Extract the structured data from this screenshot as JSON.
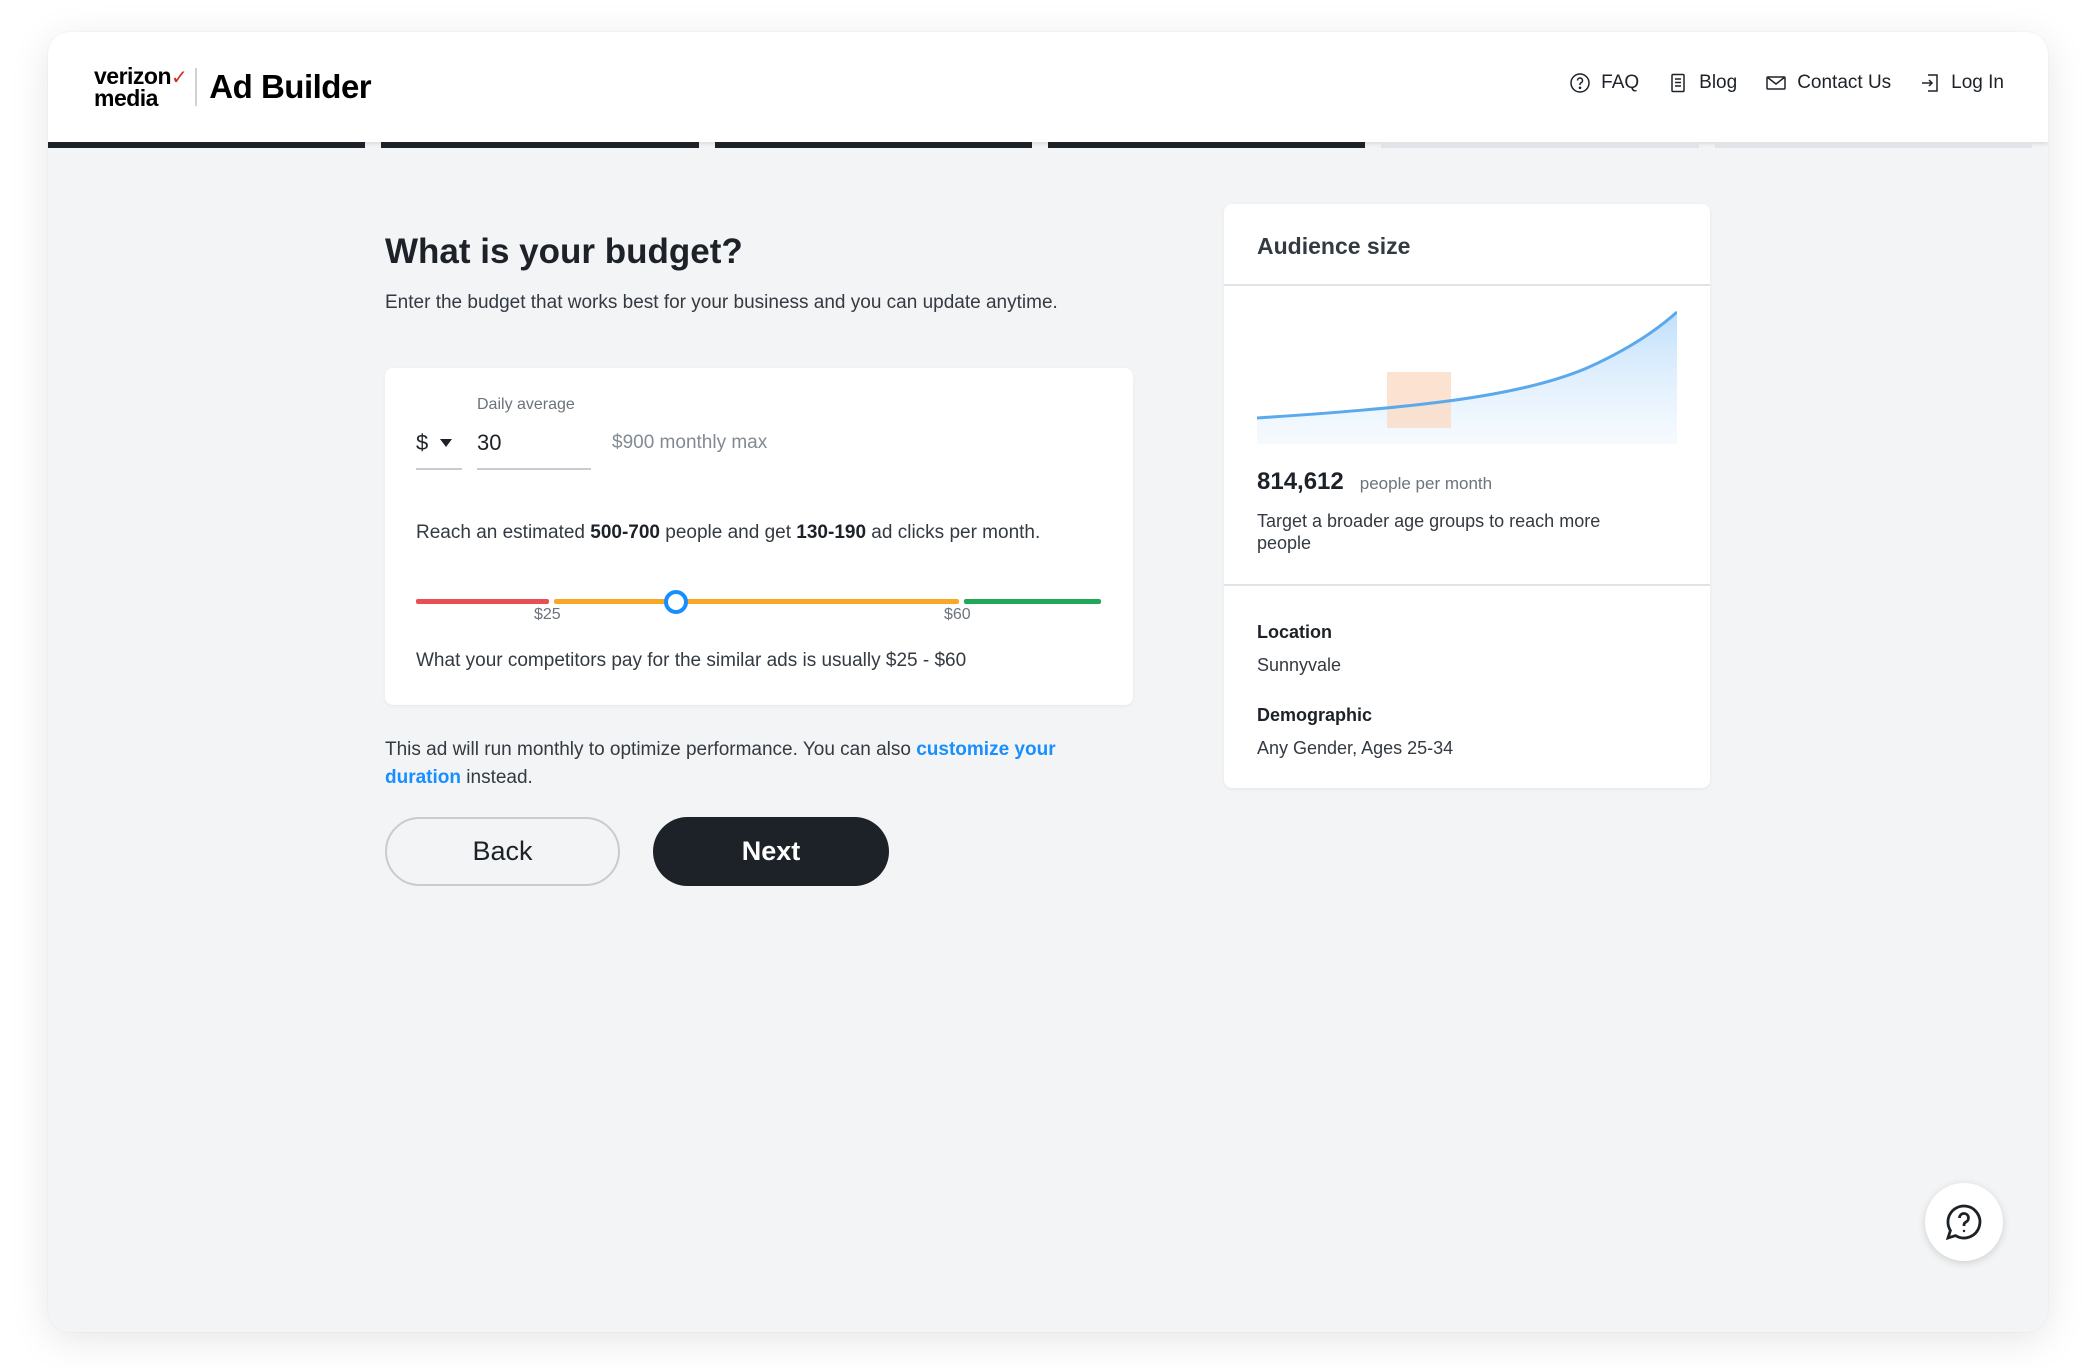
{
  "header": {
    "brand_line1": "verizon",
    "brand_check": "✓",
    "brand_line2": "media",
    "app_title": "Ad Builder",
    "nav": [
      {
        "label": "FAQ",
        "icon": "question-circle-icon"
      },
      {
        "label": "Blog",
        "icon": "document-icon"
      },
      {
        "label": "Contact Us",
        "icon": "envelope-icon"
      },
      {
        "label": "Log In",
        "icon": "login-icon"
      }
    ]
  },
  "progress": {
    "total_steps": 6,
    "completed_steps": 4,
    "done_color": "#1d2228",
    "todo_color": "#e0e4e9"
  },
  "main": {
    "title": "What is your budget?",
    "subtitle": "Enter the budget that works best for your business and you can update anytime."
  },
  "budget": {
    "currency": "$",
    "label": "Daily average",
    "value": "30",
    "monthly_max": "$900 monthly max",
    "reach_pre": "Reach an estimated ",
    "reach_people": "500-700",
    "reach_mid": " people and get ",
    "reach_clicks": "130-190",
    "reach_post": " ad clicks per month.",
    "tick_low": "$25",
    "tick_high": "$60",
    "competitors": "What your competitors pay for the similar ads is usually $25 - $60",
    "colors": {
      "low": "#eb4e52",
      "mid": "#f9a825",
      "high": "#1ea858",
      "thumb": "#188fff"
    }
  },
  "duration": {
    "pre": "This ad will run monthly to optimize performance. You can also ",
    "link": "customize your duration",
    "post": " instead."
  },
  "buttons": {
    "back": "Back",
    "next": "Next"
  },
  "audience": {
    "title": "Audience size",
    "count": "814,612",
    "unit": "people per month",
    "tip": "Target a broader age groups to reach more people",
    "location_label": "Location",
    "location_value": "Sunnyvale",
    "demographic_label": "Demographic",
    "demographic_value": "Any Gender, Ages 25-34"
  },
  "chat": {
    "icon": "chat-help-icon"
  }
}
